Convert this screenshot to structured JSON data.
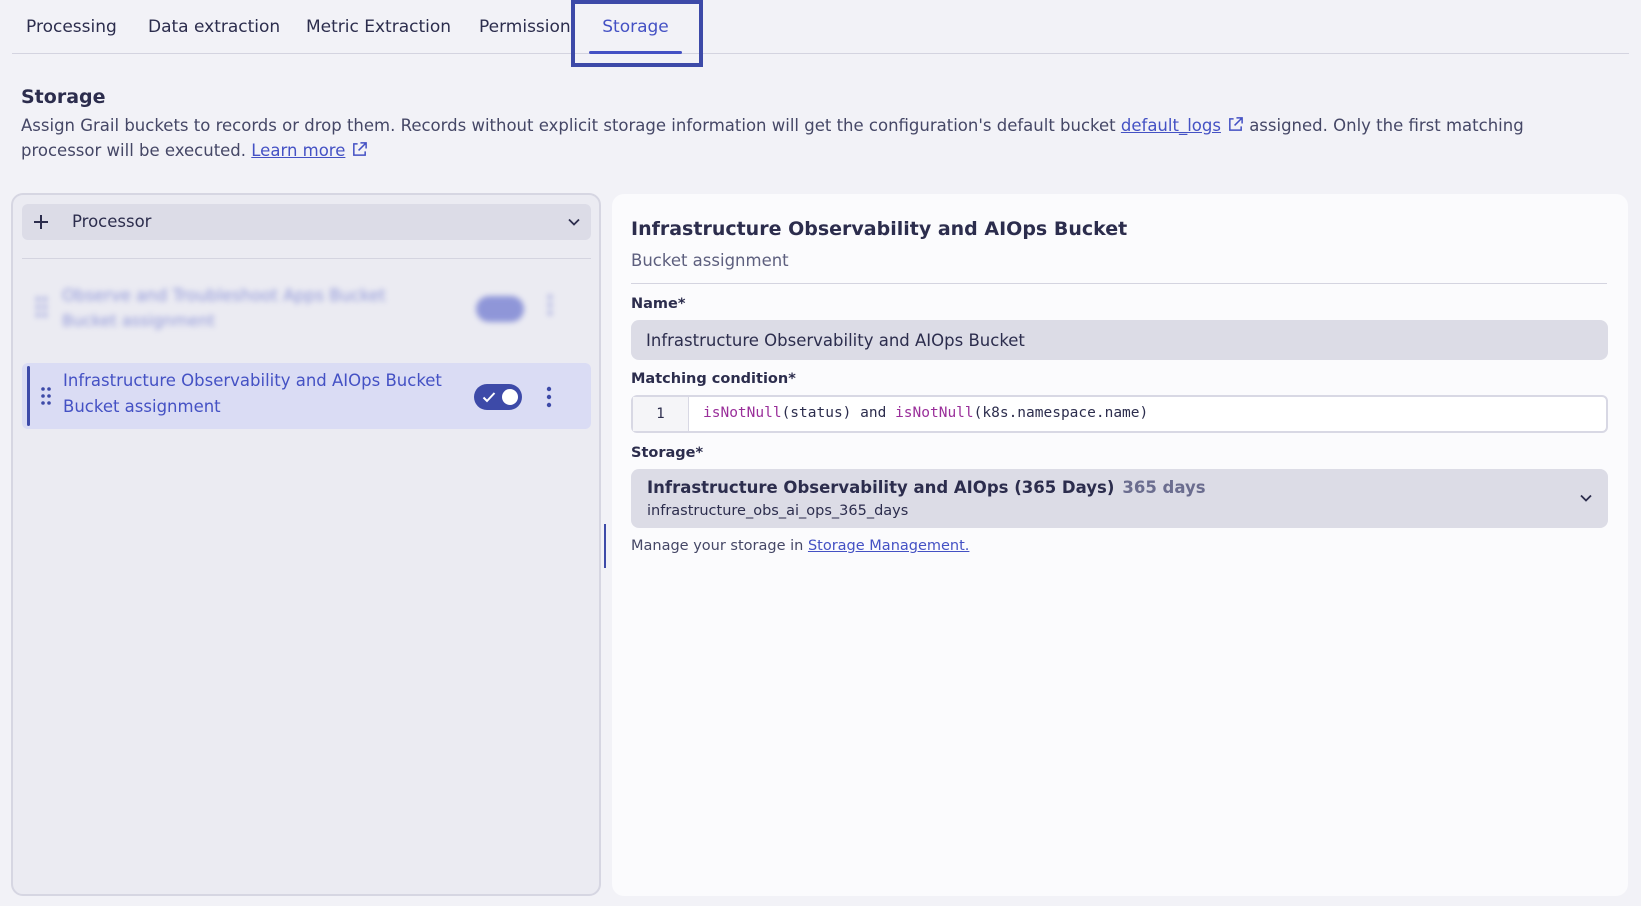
{
  "tabs": [
    {
      "label": "Processing"
    },
    {
      "label": "Data extraction"
    },
    {
      "label": "Metric Extraction"
    },
    {
      "label": "Permission"
    },
    {
      "label": "Storage",
      "active": true
    }
  ],
  "header": {
    "title": "Storage",
    "desc_part1": "Assign Grail buckets to records or drop them. Records without explicit storage information will get the configuration's default bucket ",
    "default_bucket_link": "default_logs",
    "desc_part2": " assigned. Only the first matching processor will be executed. ",
    "learn_more_link": "Learn more"
  },
  "left_panel": {
    "add_processor_label": "Processor",
    "items": [
      {
        "title": "Observe and Troubleshoot Apps Bucket",
        "subtitle": "Bucket assignment",
        "enabled": true,
        "blurred": true
      },
      {
        "title": "Infrastructure Observability and AIOps Bucket",
        "subtitle": "Bucket assignment",
        "enabled": true,
        "selected": true
      }
    ]
  },
  "detail": {
    "title": "Infrastructure Observability and AIOps Bucket",
    "subtitle": "Bucket assignment",
    "name_label": "Name*",
    "name_value": "Infrastructure Observability and AIOps Bucket",
    "condition_label": "Matching condition*",
    "condition_line_number": "1",
    "condition_fn1": "isNotNull",
    "condition_args1": "(status) and ",
    "condition_fn2": "isNotNull",
    "condition_args2": "(k8s.namespace.name)",
    "storage_label": "Storage*",
    "storage_name": "Infrastructure Observability and AIOps (365 Days)",
    "storage_days": "365 days",
    "storage_id": "infrastructure_obs_ai_ops_365_days",
    "manage_text": "Manage your storage in ",
    "manage_link": "Storage Management."
  },
  "colors": {
    "accent": "#4451c4",
    "accent_dark": "#3d4aa8",
    "background": "#f2f2f7",
    "selected_item": "#dadcf4",
    "code_function": "#9a2f9a"
  },
  "icons": {
    "add": "plus-icon",
    "dropdown": "chevron-down-icon",
    "external": "external-link-icon",
    "drag": "drag-handle-icon",
    "toggle_check": "check-icon",
    "more": "more-vertical-icon"
  }
}
